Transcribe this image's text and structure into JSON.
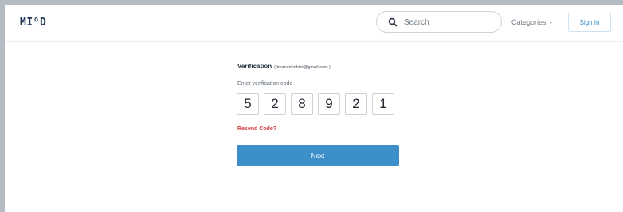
{
  "header": {
    "logo": "MIᴼD",
    "search_placeholder": "Search",
    "categories_label": "Categories",
    "signin_label": "Sign In"
  },
  "verification": {
    "title": "Verification",
    "email": "( bhoneminhtet@gmail.com )",
    "code_label": "Enter verification code",
    "code_digits": [
      "5",
      "2",
      "8",
      "9",
      "2",
      "1"
    ],
    "resend_label": "Resend Code?",
    "next_label": "Next"
  },
  "icons": {
    "search": "search-icon",
    "categories": "chevron-down-icon"
  },
  "colors": {
    "primary_button": "#3d8fc9",
    "link_red": "#d0373f",
    "signin_text": "#3d8fcb"
  }
}
